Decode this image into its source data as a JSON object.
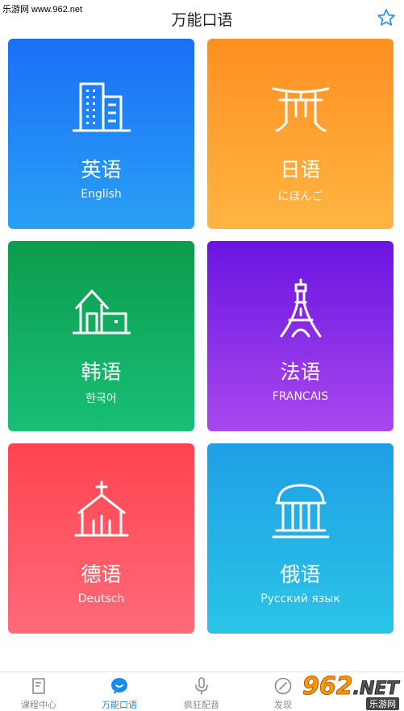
{
  "watermark": "乐游网 www.962.net",
  "header": {
    "title": "万能口语",
    "favorite_icon": "star-icon"
  },
  "languages": [
    {
      "title": "英语",
      "subtitle": "English",
      "icon": "office-building-icon",
      "color_top": "#1a6ff7",
      "color_bottom": "#2aa0f5"
    },
    {
      "title": "日语",
      "subtitle": "にほんご",
      "icon": "torii-gate-icon",
      "color_top": "#fe8f22",
      "color_bottom": "#ffb542"
    },
    {
      "title": "韩语",
      "subtitle": "한국어",
      "icon": "house-icon",
      "color_top": "#0c9c4c",
      "color_bottom": "#18bf77"
    },
    {
      "title": "法语",
      "subtitle": "FRANCAIS",
      "icon": "eiffel-tower-icon",
      "color_top": "#6a14e0",
      "color_bottom": "#a848ee"
    },
    {
      "title": "德语",
      "subtitle": "Deutsch",
      "icon": "church-icon",
      "color_top": "#ff4350",
      "color_bottom": "#ff6b79"
    },
    {
      "title": "俄语",
      "subtitle": "Русский язык",
      "icon": "temple-columns-icon",
      "color_top": "#1f9fe6",
      "color_bottom": "#2ac4e6"
    }
  ],
  "tabbar": {
    "tabs": [
      {
        "label": "课程中心",
        "icon": "course-book-icon",
        "active": false
      },
      {
        "label": "万能口语",
        "icon": "chat-bubble-icon",
        "active": true
      },
      {
        "label": "疯狂配音",
        "icon": "microphone-icon",
        "active": false
      },
      {
        "label": "发现",
        "icon": "compass-icon",
        "active": false
      }
    ],
    "active_color": "#1a8cf0",
    "inactive_color": "#8a8a8a"
  },
  "logo_watermark": {
    "number": "962",
    "domain": ".NET",
    "caption": "乐游网"
  }
}
